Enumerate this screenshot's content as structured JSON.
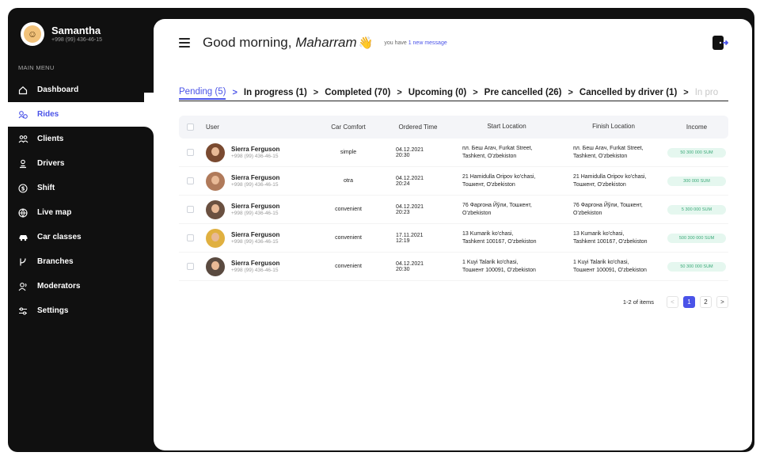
{
  "profile": {
    "name": "Samantha",
    "phone": "+998 (99) 436-46-15"
  },
  "menu": {
    "title": "MAIN MENU",
    "items": [
      {
        "label": "Dashboard",
        "icon": "home-icon"
      },
      {
        "label": "Rides",
        "icon": "rides-icon"
      },
      {
        "label": "Clients",
        "icon": "clients-icon"
      },
      {
        "label": "Drivers",
        "icon": "driver-icon"
      },
      {
        "label": "Shift",
        "icon": "dollar-icon"
      },
      {
        "label": "Live map",
        "icon": "globe-icon"
      },
      {
        "label": "Car classes",
        "icon": "car-icon"
      },
      {
        "label": "Branches",
        "icon": "branch-icon"
      },
      {
        "label": "Moderators",
        "icon": "moderators-icon"
      },
      {
        "label": "Settings",
        "icon": "settings-icon"
      }
    ]
  },
  "header": {
    "greeting": "Good morning, ",
    "name": "Maharram",
    "wave": "👋",
    "msg_prefix": "you have ",
    "msg_link": "1 new message"
  },
  "tabs": [
    {
      "label": "Pending (5)"
    },
    {
      "label": "In progress (1)"
    },
    {
      "label": "Completed (70)"
    },
    {
      "label": "Upcoming (0)"
    },
    {
      "label": "Pre cancelled (26)"
    },
    {
      "label": "Cancelled by driver (1)"
    },
    {
      "label": "In pro"
    }
  ],
  "table": {
    "columns": {
      "user": "User",
      "comfort": "Car Comfort",
      "time": "Ordered Time",
      "start": "Start Location",
      "finish": "Finish Location",
      "income": "Income"
    },
    "rows": [
      {
        "name": "Sierra Ferguson",
        "phone": "+998 (99) 436-46-15",
        "comfort": "simple",
        "date": "04.12.2021",
        "time": "20:30",
        "start1": "пл. Беш Агач, Furkat Street,",
        "start2": "Tashkent, O'zbekiston",
        "finish1": "пл. Беш Агач, Furkat Street,",
        "finish2": "Tashkent, O'zbekiston",
        "income": "50 300 000 SUM",
        "face": "#7a4a30"
      },
      {
        "name": "Sierra Ferguson",
        "phone": "+998 (99) 436-46-15",
        "comfort": "otra",
        "date": "04.12.2021",
        "time": "20:24",
        "start1": "21 Hamidulla Oripov ko'chasi,",
        "start2": "Тошкент, O'zbekiston",
        "finish1": "21 Hamidulla Oripov ko'chasi,",
        "finish2": "Тошкент, O'zbekiston",
        "income": "300 000 SUM",
        "face": "#b07a5a"
      },
      {
        "name": "Sierra Ferguson",
        "phone": "+998 (99) 436-46-15",
        "comfort": "convenient",
        "date": "04.12.2021",
        "time": "20:23",
        "start1": "76 Фаргона Йўли, Тошкент,",
        "start2": "O'zbekiston",
        "finish1": "76 Фаргона Йўли, Тошкент,",
        "finish2": "O'zbekiston",
        "income": "5 300 000 SUM",
        "face": "#6a5040"
      },
      {
        "name": "Sierra Ferguson",
        "phone": "+998 (99) 436-46-15",
        "comfort": "convenient",
        "date": "17.11.2021",
        "time": "12:19",
        "start1": "13 Kumarik ko'chasi,",
        "start2": "Tashkent 100167, O'zbekiston",
        "finish1": "13 Kumarik ko'chasi,",
        "finish2": "Tashkent 100167, O'zbekiston",
        "income": "500 300 000 SUM",
        "face": "#e0b040"
      },
      {
        "name": "Sierra Ferguson",
        "phone": "+998 (99) 436-46-15",
        "comfort": "convenient",
        "date": "04.12.2021",
        "time": "20:30",
        "start1": "1 Kuyi Talarik ko'chasi,",
        "start2": "Тошкент 100091, O'zbekiston",
        "finish1": "1 Kuyi Talarik ko'chasi,",
        "finish2": "Тошкент 100091, O'zbekiston",
        "income": "50 300 000 SUM",
        "face": "#5a4a40"
      }
    ]
  },
  "pager": {
    "info": "1-2 of items",
    "prev": "<",
    "page1": "1",
    "page2": "2",
    "next": ">"
  },
  "colors": {
    "accent": "#4a53e8",
    "dark": "#101010",
    "income_bg": "#e5f7ef",
    "income_text": "#3aa978"
  }
}
